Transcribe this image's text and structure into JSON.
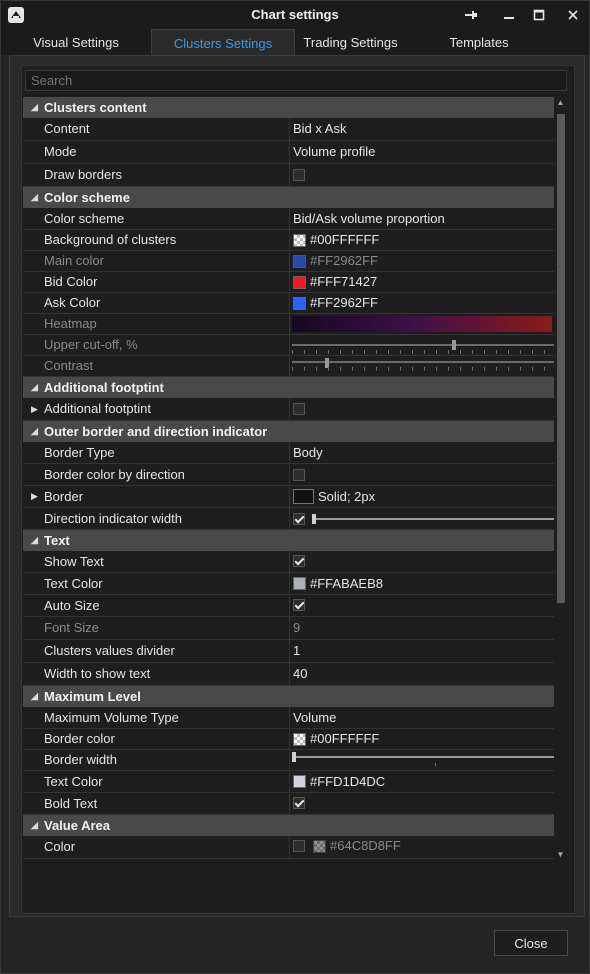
{
  "window": {
    "title": "Chart settings",
    "tabs": [
      {
        "label": "Visual Settings",
        "active": false
      },
      {
        "label": "Clusters Settings",
        "active": true
      },
      {
        "label": "Trading Settings",
        "active": false
      },
      {
        "label": "Templates",
        "active": false
      }
    ],
    "close_button": "Close",
    "accent_color": "#3C9AE8"
  },
  "search": {
    "placeholder": "Search"
  },
  "sections": {
    "clusters_content": {
      "title": "Clusters content",
      "content": {
        "label": "Content",
        "value": "Bid x Ask"
      },
      "mode": {
        "label": "Mode",
        "value": "Volume profile"
      },
      "draw_borders": {
        "label": "Draw borders",
        "checked": false
      }
    },
    "color_scheme": {
      "title": "Color scheme",
      "color_scheme": {
        "label": "Color scheme",
        "value": "Bid/Ask volume proportion"
      },
      "background": {
        "label": "Background of clusters",
        "value": "#00FFFFFF"
      },
      "main_color": {
        "label": "Main color",
        "value": "#FF2962FF",
        "swatch": "#2962ff",
        "disabled": true
      },
      "bid_color": {
        "label": "Bid Color",
        "value": "#FFF71427",
        "swatch": "#f71427"
      },
      "ask_color": {
        "label": "Ask Color",
        "value": "#FF2962FF",
        "swatch": "#2962ff"
      },
      "heatmap": {
        "label": "Heatmap",
        "disabled": true
      },
      "upper_cutoff": {
        "label": "Upper cut-off, %",
        "disabled": true,
        "level": 0.62
      },
      "contrast": {
        "label": "Contrast",
        "disabled": true,
        "level": 0.14
      }
    },
    "additional_footprint": {
      "title": "Additional footptint",
      "item": {
        "label": "Additional footptint",
        "checked": false
      }
    },
    "outer_border": {
      "title": "Outer border and direction indicator",
      "border_type": {
        "label": "Border Type",
        "value": "Body"
      },
      "border_color_by_direction": {
        "label": "Border color by direction",
        "checked": false
      },
      "border": {
        "label": "Border",
        "value": "Solid; 2px"
      },
      "direction_indicator_width": {
        "label": "Direction indicator width",
        "checked": true,
        "level": 0.0
      }
    },
    "text": {
      "title": "Text",
      "show_text": {
        "label": "Show Text",
        "checked": true
      },
      "text_color": {
        "label": "Text Color",
        "value": "#FFABAEB8",
        "swatch": "#abaeb8"
      },
      "auto_size": {
        "label": "Auto Size",
        "checked": true
      },
      "font_size": {
        "label": "Font Size",
        "value": "9",
        "disabled": true
      },
      "clusters_values_divider": {
        "label": "Clusters values divider",
        "value": "1"
      },
      "width_to_show_text": {
        "label": "Width to show text",
        "value": "40"
      }
    },
    "maximum_level": {
      "title": "Maximum Level",
      "maximum_volume_type": {
        "label": "Maximum Volume Type",
        "value": "Volume"
      },
      "border_color": {
        "label": "Border color",
        "value": "#00FFFFFF"
      },
      "border_width": {
        "label": "Border width",
        "level": 0.0
      },
      "text_color": {
        "label": "Text Color",
        "value": "#FFD1D4DC",
        "swatch": "#d1d4dc"
      },
      "bold_text": {
        "label": "Bold Text",
        "checked": true
      }
    },
    "value_area": {
      "title": "Value Area",
      "color": {
        "label": "Color",
        "value": "#64C8D8FF",
        "checked": false,
        "disabled_value": true
      }
    }
  }
}
